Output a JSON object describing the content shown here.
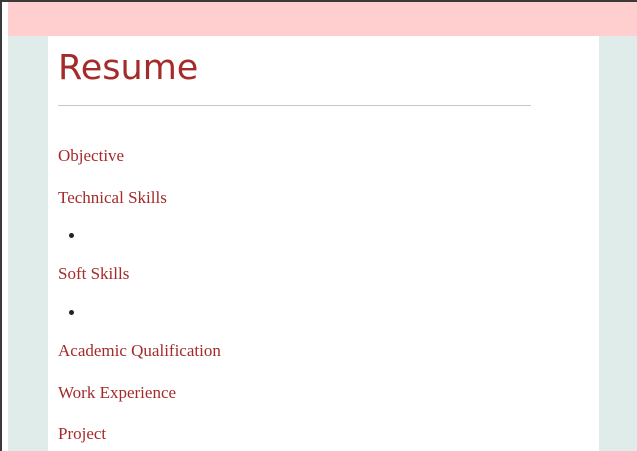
{
  "page": {
    "title": "Resume",
    "colors": {
      "accent": "#a52a2a",
      "top_bar": "#ffcfcf",
      "page_background": "#e0ecea",
      "card": "#ffffff"
    }
  },
  "sections": [
    {
      "label": "Objective"
    },
    {
      "label": "Technical Skills",
      "items": [
        ""
      ]
    },
    {
      "label": "Soft Skills",
      "items": [
        ""
      ]
    },
    {
      "label": "Academic Qualification"
    },
    {
      "label": "Work Experience"
    },
    {
      "label": "Project"
    }
  ]
}
